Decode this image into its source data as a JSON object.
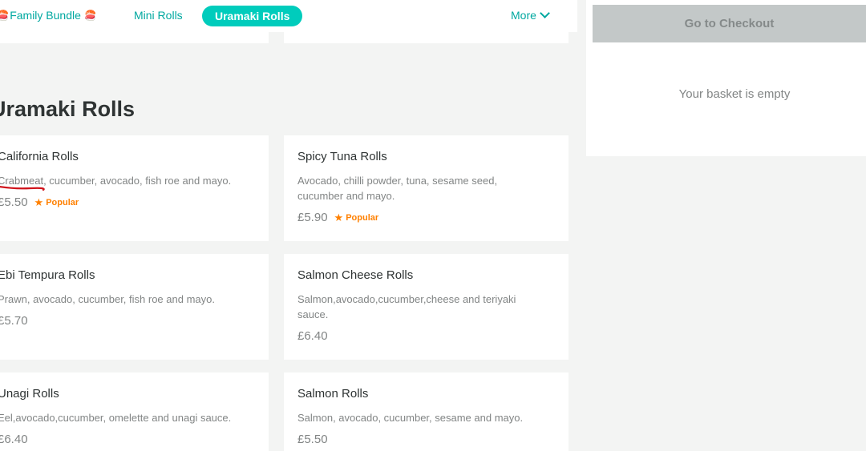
{
  "nav": {
    "family_bundle": "Family Bundle",
    "mini_rolls": "Mini Rolls",
    "uramaki_rolls": "Uramaki Rolls",
    "more": "More"
  },
  "section": {
    "title": "Uramaki Rolls"
  },
  "items": [
    {
      "name": "California Rolls",
      "desc": "Crabmeat, cucumber, avocado, fish roe and mayo.",
      "price": "£5.50",
      "popular": "Popular"
    },
    {
      "name": "Spicy Tuna Rolls",
      "desc": "Avocado, chilli powder, tuna, sesame seed, cucumber and mayo.",
      "price": "£5.90",
      "popular": "Popular"
    },
    {
      "name": "Ebi Tempura Rolls",
      "desc": "Prawn, avocado, cucumber, fish roe and mayo.",
      "price": "£5.70"
    },
    {
      "name": "Salmon Cheese Rolls",
      "desc": "Salmon,avocado,cucumber,cheese and teriyaki sauce.",
      "price": "£6.40"
    },
    {
      "name": "Unagi Rolls",
      "desc": "Eel,avocado,cucumber, omelette and unagi sauce.",
      "price": "£6.40"
    },
    {
      "name": "Salmon Rolls",
      "desc": "Salmon, avocado, cucumber, sesame and mayo.",
      "price": "£5.50"
    }
  ],
  "basket": {
    "checkout_label": "Go to Checkout",
    "empty_text": "Your basket is empty"
  },
  "colors": {
    "accent": "#00ccbc",
    "popular": "#ff8000",
    "annotation": "#d0141c"
  },
  "icons": {
    "sushi": "sushi-icon",
    "star": "star-icon",
    "chevron": "chevron-down-icon"
  }
}
